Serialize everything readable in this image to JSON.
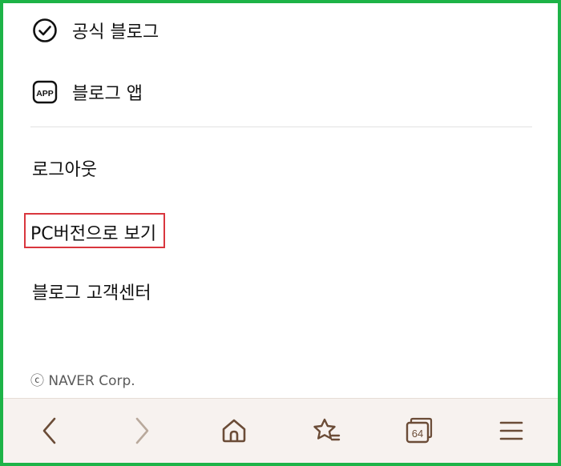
{
  "menu": {
    "official_blog": "공식 블로그",
    "blog_app": "블로그 앱",
    "app_badge": "APP",
    "logout": "로그아웃",
    "pc_version": "PC버전으로 보기",
    "help_center": "블로그 고객센터"
  },
  "footer": {
    "copyright": "ⓒ NAVER Corp."
  },
  "toolbar": {
    "tab_count": "64",
    "icons": [
      "back-icon",
      "forward-icon",
      "home-icon",
      "bookmark-star-icon",
      "tabs-icon",
      "menu-icon"
    ]
  },
  "colors": {
    "frame": "#1db347",
    "highlight": "#d9363e",
    "toolbar_bg": "#f7f2ef",
    "toolbar_icon": "#6b4c37"
  }
}
